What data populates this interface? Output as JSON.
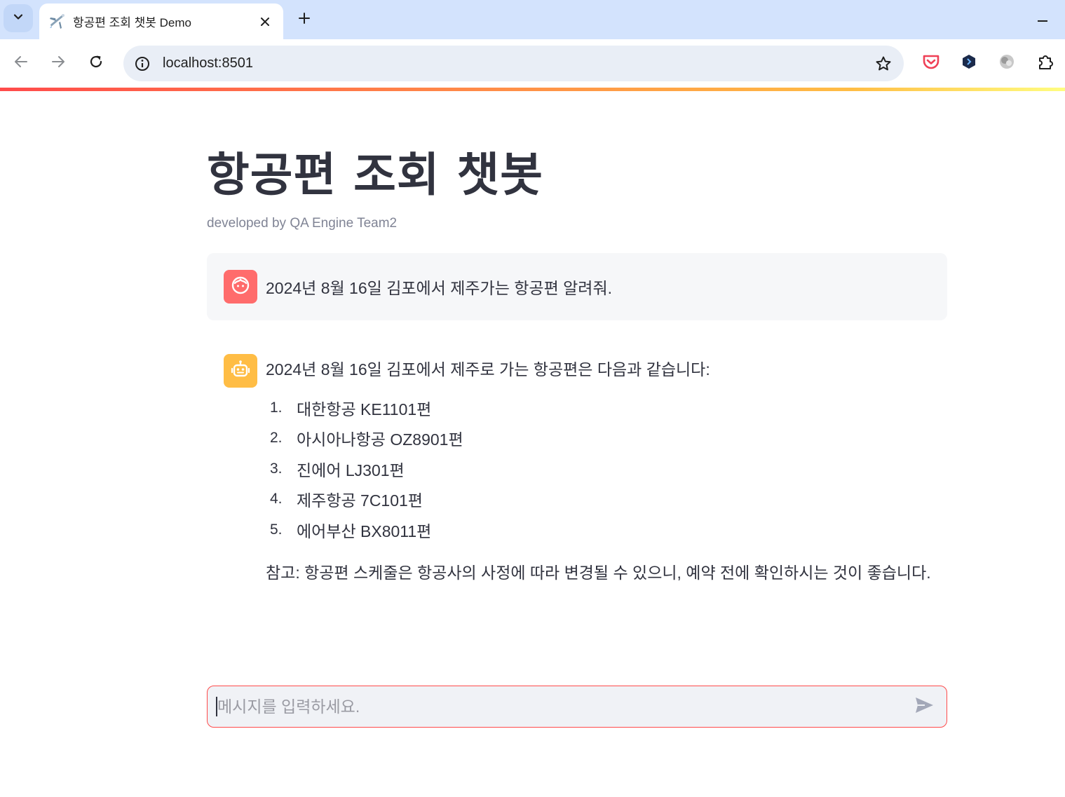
{
  "browser": {
    "tab": {
      "favicon": "airplane-emoji",
      "title": "항공편 조회 챗봇 Demo"
    },
    "address": {
      "url": "localhost:8501"
    },
    "icons": [
      "tab-search-icon",
      "close-icon",
      "plus-icon",
      "minimize-icon",
      "back-arrow-icon",
      "forward-arrow-icon",
      "reload-icon",
      "info-icon",
      "star-icon",
      "pocket-icon",
      "extension-hex-icon",
      "extension-ball-icon",
      "puzzle-icon"
    ]
  },
  "app": {
    "title": "항공편 조회 챗봇",
    "caption": "developed by QA Engine Team2",
    "accent_color": "#ff4b4b",
    "messages": {
      "user": {
        "avatar": "face-icon",
        "avatar_color": "#ff6c6c",
        "text": "2024년 8월 16일 김포에서 제주가는 항공편 알려줘."
      },
      "assistant": {
        "avatar": "robot-icon",
        "avatar_color": "#ffbd45",
        "intro": "2024년 8월 16일 김포에서 제주로 가는 항공편은 다음과 같습니다:",
        "flights": [
          {
            "num": "1.",
            "text": "대한항공 KE1101편"
          },
          {
            "num": "2.",
            "text": "아시아나항공 OZ8901편"
          },
          {
            "num": "3.",
            "text": "진에어 LJ301편"
          },
          {
            "num": "4.",
            "text": "제주항공 7C101편"
          },
          {
            "num": "5.",
            "text": "에어부산 BX8011편"
          }
        ],
        "note": "참고: 항공편 스케줄은 항공사의 사정에 따라 변경될 수 있으니, 예약 전에 확인하시는 것이 좋습니다."
      }
    },
    "chat_input": {
      "placeholder": "메시지를 입력하세요.",
      "value": ""
    }
  }
}
